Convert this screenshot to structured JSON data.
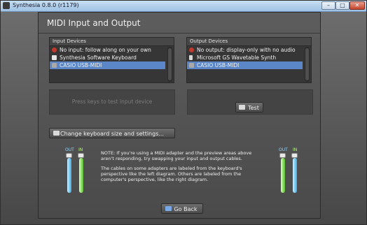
{
  "window": {
    "title": "Synthesia 0.8.0 (r1179)"
  },
  "dialog": {
    "title": "MIDI Input and Output"
  },
  "input_devices": {
    "header": "Input Devices",
    "items": [
      {
        "label": "No input: follow along on your own",
        "icon": "no-input-icon",
        "selected": false
      },
      {
        "label": "Synthesia Software Keyboard",
        "icon": "keyboard-icon",
        "selected": false
      },
      {
        "label": "CASIO USB-MIDI",
        "icon": "usb-device-icon",
        "selected": true
      }
    ]
  },
  "output_devices": {
    "header": "Output Devices",
    "items": [
      {
        "label": "No output: display-only with no audio",
        "icon": "no-output-icon",
        "selected": false
      },
      {
        "label": "Microsoft GS Wavetable Synth",
        "icon": "speaker-icon",
        "selected": false
      },
      {
        "label": "CASIO USB-MIDI",
        "icon": "usb-device-icon",
        "selected": true
      }
    ]
  },
  "input_test": {
    "hint": "Press keys to test input device"
  },
  "buttons": {
    "test": "Test",
    "keyboard_settings": "Change keyboard size and settings...",
    "back": "Go Back"
  },
  "note": {
    "paragraph1": "NOTE: If you're using a MIDI adapter and the preview areas above aren't responding, try swapping your input and output cables.",
    "paragraph2": "The cables on some adapters are labeled from the keyboard's perspective like the left diagram.  Others are labeled from the computer's perspective, like the right diagram."
  },
  "cable_labels": {
    "out": "OUT",
    "in": "IN"
  },
  "colors": {
    "selection": "#5b86c8",
    "out_cable": "#3aaee8",
    "in_cable": "#54c02b"
  }
}
